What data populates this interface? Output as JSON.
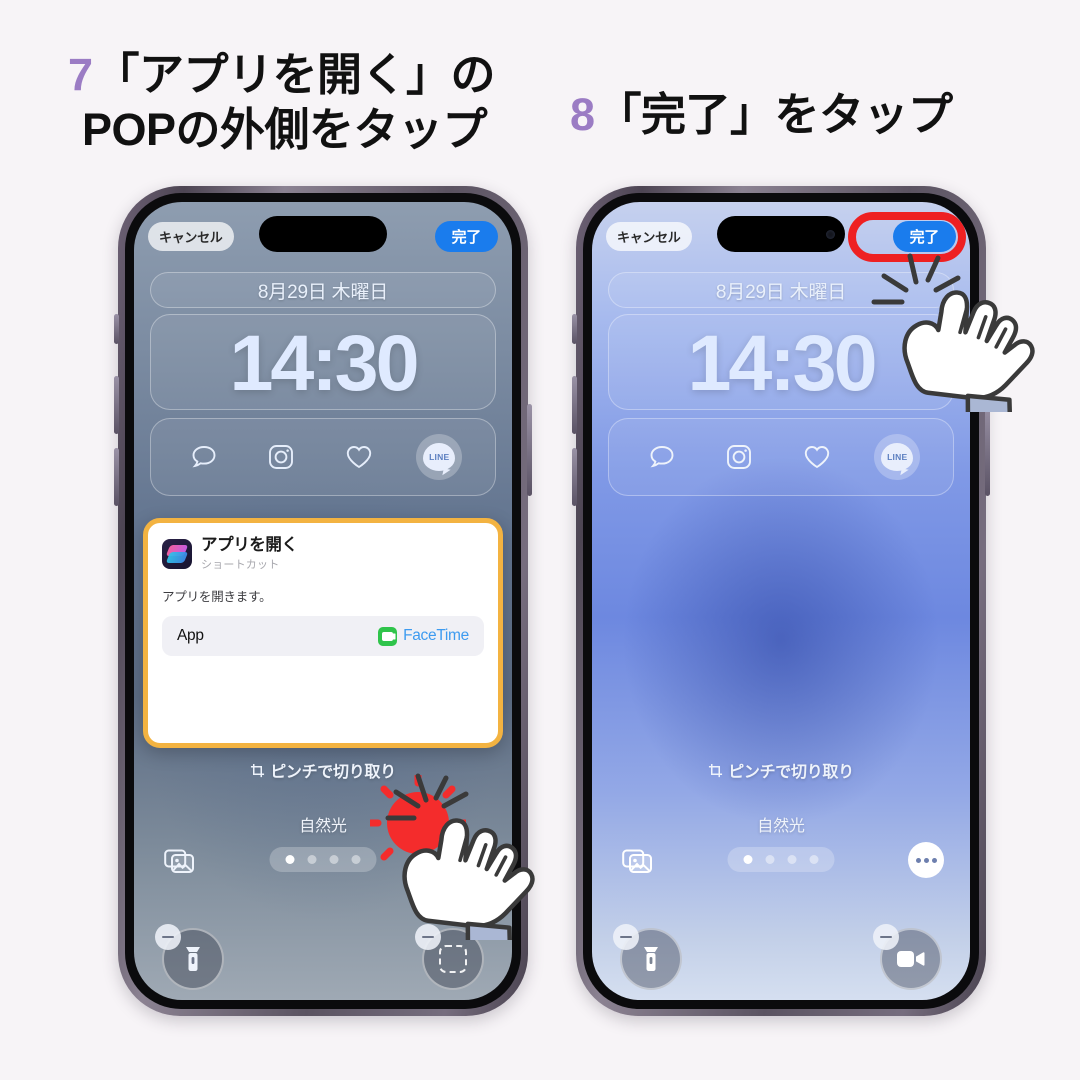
{
  "background_color": "#f7f4f7",
  "accent_number_color": "#9b7cc4",
  "highlight_ring_color": "#ee2022",
  "popup_border_color": "#f3b341",
  "steps": [
    {
      "number": "7",
      "line1": "「アプリを開く」の",
      "line2": "POPの外側をタップ"
    },
    {
      "number": "8",
      "line1": "「完了」をタップ"
    }
  ],
  "phone_left": {
    "cancel_label": "キャンセル",
    "done_label": "完了",
    "date": "8月29日 木曜日",
    "time": "14:30",
    "app_icons": [
      "message-icon",
      "instagram-icon",
      "heart-icon",
      "line-icon"
    ],
    "line_label": "LINE",
    "pinch_label": "ピンチで切り取り",
    "light_label": "自然光",
    "dots_count": 4,
    "dots_active_index": 0,
    "quick_action_left": "flashlight-icon",
    "quick_action_right": "empty-widget-placeholder",
    "popup": {
      "title": "アプリを開く",
      "subtitle": "ショートカット",
      "description": "アプリを開きます。",
      "field_key": "App",
      "field_value": "FaceTime"
    }
  },
  "phone_right": {
    "cancel_label": "キャンセル",
    "done_label": "完了",
    "date": "8月29日 木曜日",
    "time": "14:30",
    "app_icons": [
      "message-icon",
      "instagram-icon",
      "heart-icon",
      "line-icon"
    ],
    "line_label": "LINE",
    "pinch_label": "ピンチで切り取り",
    "light_label": "自然光",
    "dots_count": 4,
    "dots_active_index": 0,
    "quick_action_left": "flashlight-icon",
    "quick_action_right": "facetime-video-icon"
  }
}
